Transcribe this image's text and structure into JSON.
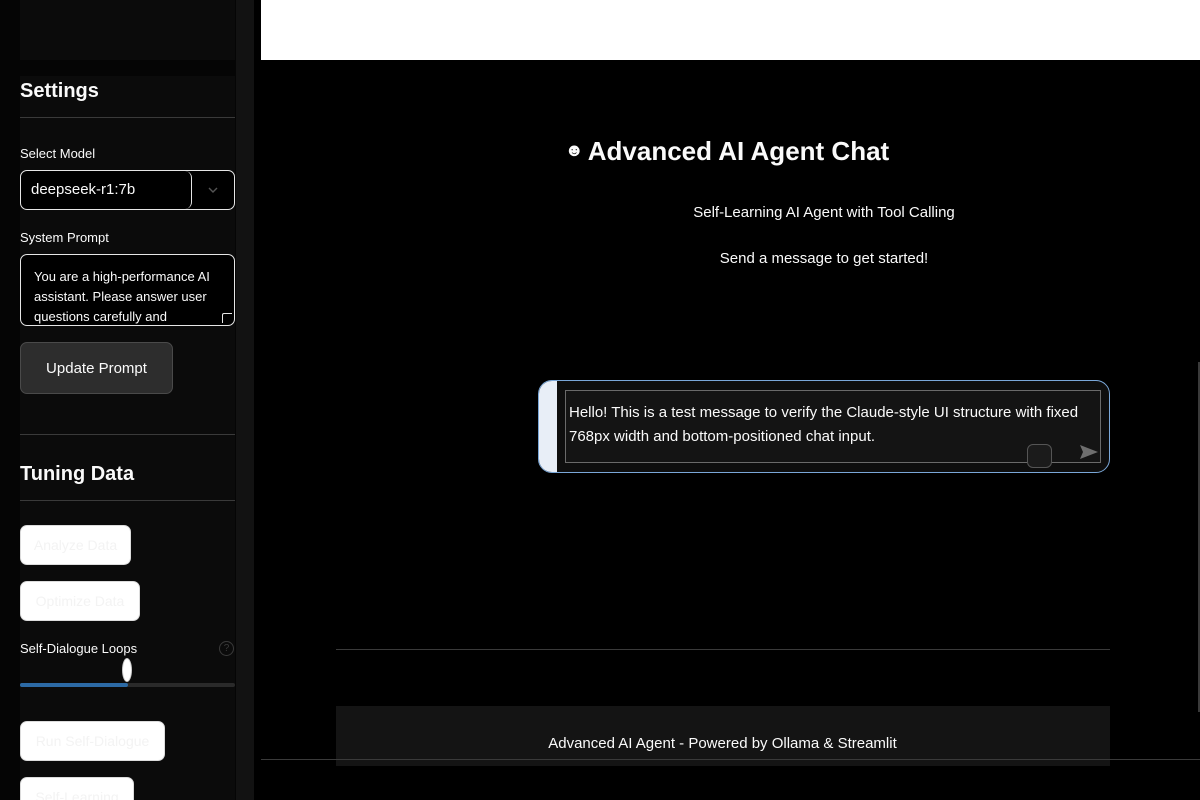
{
  "sidebar": {
    "settings_heading": "Settings",
    "model_label": "Select Model",
    "model_value": "deepseek-r1:7b",
    "system_prompt_label": "System Prompt",
    "system_prompt_value": "You are a high-performance AI assistant. Please answer user questions carefully and",
    "update_prompt_button": "Update Prompt",
    "tuning_heading": "Tuning Data",
    "analyze_button": "Analyze Data",
    "optimize_button": "Optimize Data",
    "loops_label": "Self-Dialogue Loops",
    "loops_slider_fraction": 0.5,
    "run_dialogue_button": "Run Self-Dialogue",
    "self_learning_button": "Self-Learning"
  },
  "main": {
    "title": "Advanced AI Agent Chat",
    "title_icon": "robot-face-icon",
    "subtitle": "Self-Learning AI Agent with Tool Calling",
    "hint": "Send a message to get started!",
    "chat_input_value": "Hello! This is a test message to verify the Claude-style UI structure with fixed 768px width and bottom-positioned chat input.",
    "footer": "Advanced AI Agent - Powered by Ollama & Streamlit"
  },
  "colors": {
    "accent": "#2c6aa5",
    "chat_border": "#7aa7d8"
  }
}
